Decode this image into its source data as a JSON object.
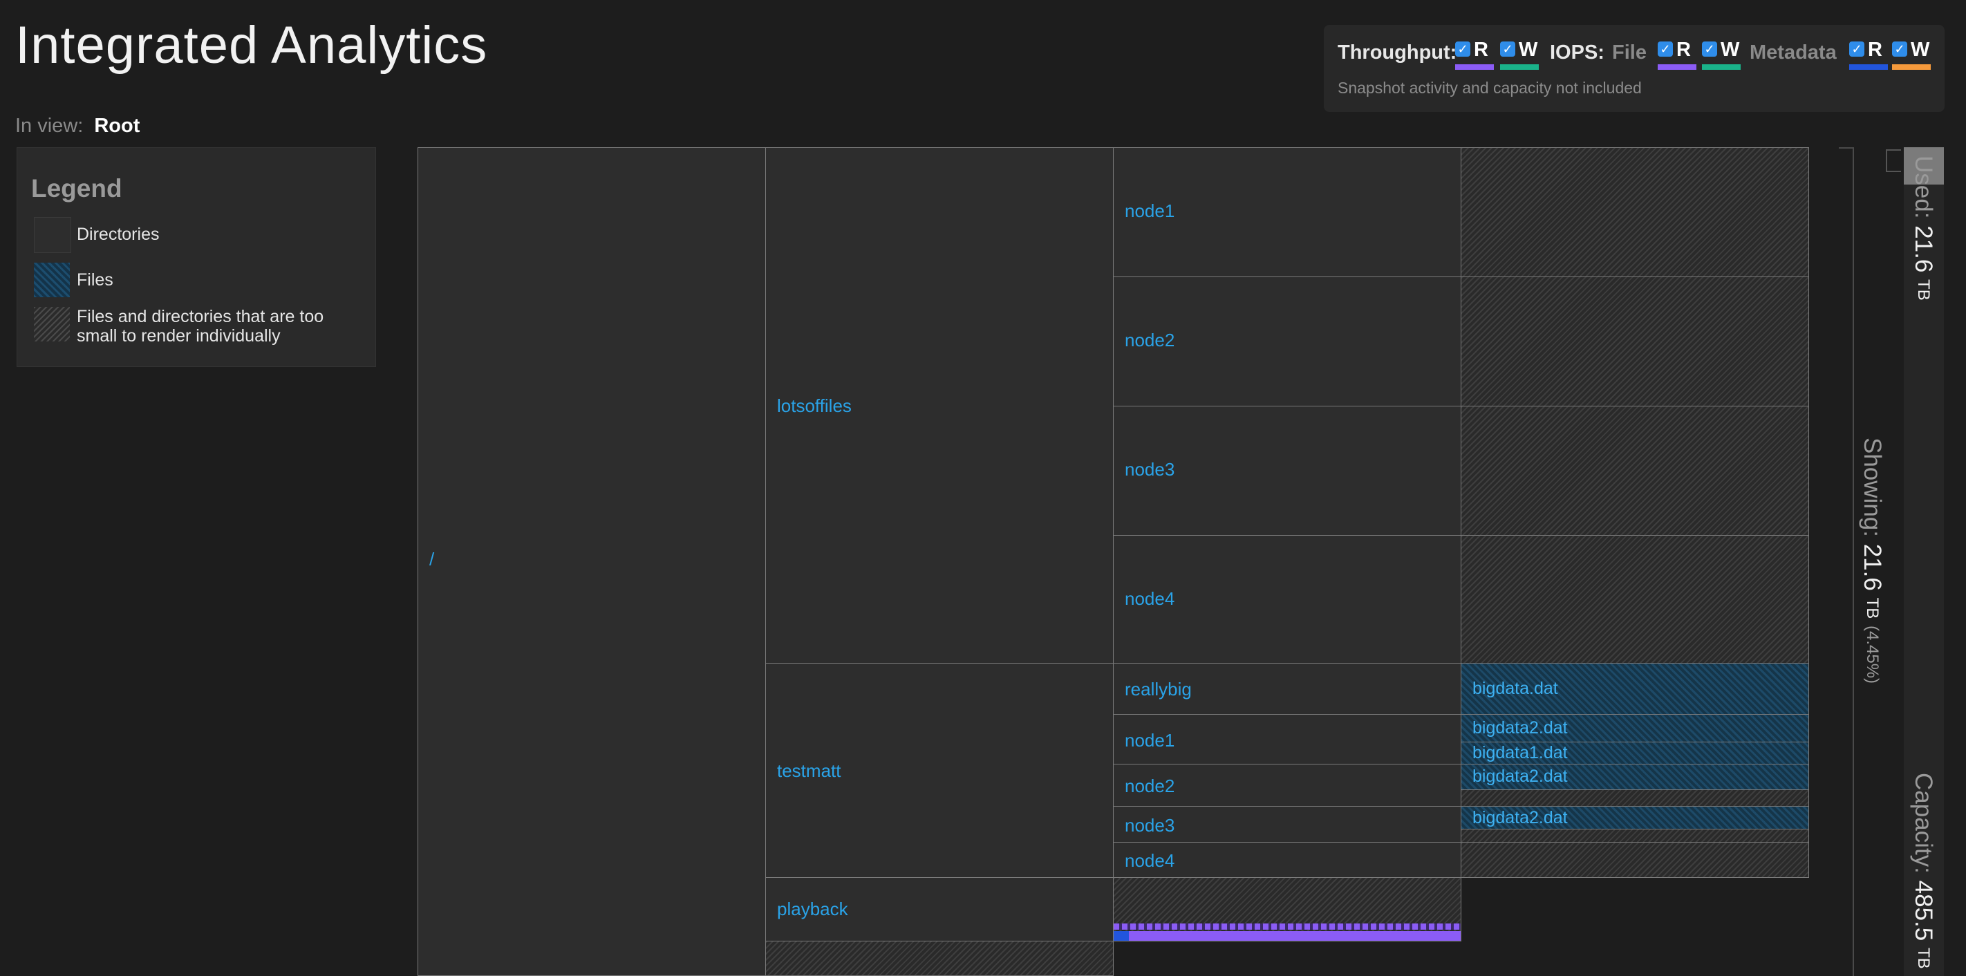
{
  "app_title": "Integrated Analytics",
  "inview": {
    "label": "In view:",
    "value": "Root"
  },
  "legend": {
    "title": "Legend",
    "items": [
      {
        "label": "Directories"
      },
      {
        "label": "Files"
      },
      {
        "label": "Files and directories that are too small to render individually"
      }
    ]
  },
  "toolbar": {
    "throughput_label": "Throughput:",
    "iops_label": "IOPS:",
    "file_label": "File",
    "metadata_label": "Metadata",
    "read_label": "R",
    "write_label": "W",
    "check_glyph": "✓",
    "note": "Snapshot activity and capacity not included",
    "colors": {
      "tp_read": "#8b5cf6",
      "tp_write": "#1ab38a",
      "file_read": "#8b5cf6",
      "file_write": "#1ab38a",
      "meta_read": "#2255dd",
      "meta_write": "#f59a3c"
    }
  },
  "tree": {
    "root": "/",
    "lotsoffiles": {
      "name": "lotsoffiles",
      "children": [
        "node1",
        "node2",
        "node3",
        "node4"
      ]
    },
    "testmatt": {
      "name": "testmatt",
      "children": [
        "reallybig",
        "node1",
        "node2",
        "node3",
        "node4"
      ],
      "files": [
        "bigdata.dat",
        "bigdata2.dat",
        "bigdata1.dat",
        "bigdata2.dat",
        "bigdata2.dat"
      ]
    },
    "playback": {
      "name": "playback"
    }
  },
  "sidebar_stats": {
    "used_label": "Used:",
    "used_value": "21.6",
    "used_unit": "TB",
    "showing_label": "Showing:",
    "showing_value": "21.6",
    "showing_unit": "TB",
    "showing_pct": "(4.45%)",
    "capacity_label": "Capacity:",
    "capacity_value": "485.5",
    "capacity_unit": "TB"
  }
}
